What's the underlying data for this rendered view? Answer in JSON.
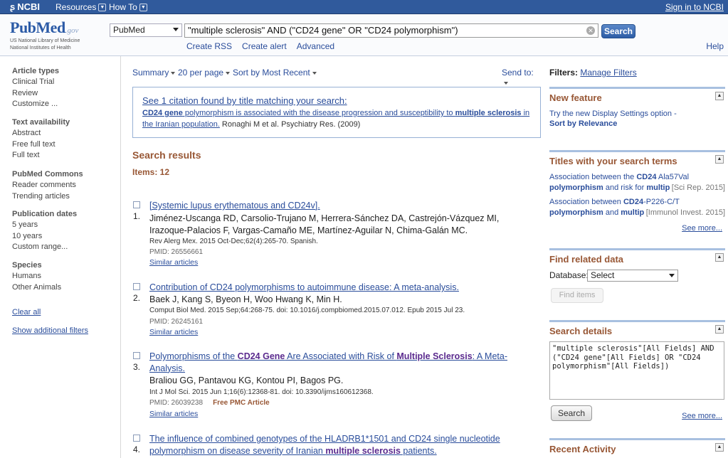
{
  "topbar": {
    "brand": "NCBI",
    "resources": "Resources",
    "howto": "How To",
    "signin": "Sign in to NCBI"
  },
  "header": {
    "logo_text": "PubMed",
    "logo_gov": ".gov",
    "nlm_line1": "US National Library of Medicine",
    "nlm_line2": "National Institutes of Health",
    "database": "PubMed",
    "query": "\"multiple sclerosis\" AND (\"CD24 gene\" OR \"CD24 polymorphism\")",
    "search_label": "Search",
    "create_rss": "Create RSS",
    "create_alert": "Create alert",
    "advanced": "Advanced",
    "help": "Help"
  },
  "sidebar": {
    "article_types": {
      "title": "Article types",
      "items": [
        "Clinical Trial",
        "Review",
        "Customize ..."
      ]
    },
    "text_availability": {
      "title": "Text availability",
      "items": [
        "Abstract",
        "Free full text",
        "Full text"
      ]
    },
    "pubmed_commons": {
      "title": "PubMed Commons",
      "items": [
        "Reader comments",
        "Trending articles"
      ]
    },
    "publication_dates": {
      "title": "Publication dates",
      "items": [
        "5 years",
        "10 years",
        "Custom range..."
      ]
    },
    "species": {
      "title": "Species",
      "items": [
        "Humans",
        "Other Animals"
      ]
    },
    "clear_all": "Clear all",
    "show_filters": "Show additional filters"
  },
  "toolbar": {
    "summary": "Summary",
    "per_page": "20 per page",
    "sort": "Sort by Most Recent",
    "send_to": "Send to:"
  },
  "citation": {
    "title": "See 1 citation found by title matching your search:",
    "link_part1": "CD24 gene",
    "link_part2": " polymorphism is associated with the disease progression and susceptibility to ",
    "link_part3": "multiple sclerosis",
    "link_part4": " in the Iranian population.",
    "source": " Ronaghi M et al. Psychiatry Res. (2009)"
  },
  "results": {
    "heading": "Search results",
    "count": "Items: 12",
    "items": [
      {
        "num": "1.",
        "title": "[Systemic lupus erythematous and CD24v].",
        "authors": "Jiménez-Uscanga RD, Carsolio-Trujano M, Herrera-Sánchez DA, Castrejón-Vázquez MI, Irazoque-Palacios F, Vargas-Camaño ME, Martínez-Aguilar N, Chima-Galán MC.",
        "journal": "Rev Alerg Mex. 2015 Oct-Dec;62(4):265-70. Spanish.",
        "pmid": "PMID: 26556661",
        "similar": "Similar articles"
      },
      {
        "num": "2.",
        "title": "Contribution of CD24 polymorphisms to autoimmune disease: A meta-analysis.",
        "authors": "Baek J, Kang S, Byeon H, Woo Hwang K, Min H.",
        "journal": "Comput Biol Med. 2015 Sep;64:268-75. doi: 10.1016/j.compbiomed.2015.07.012. Epub 2015 Jul 23.",
        "pmid": "PMID: 26245161",
        "similar": "Similar articles"
      },
      {
        "num": "3.",
        "title_a": "Polymorphisms of the ",
        "title_b": "CD24 Gene",
        "title_c": " Are Associated with Risk of ",
        "title_d": "Multiple Sclerosis",
        "title_e": ": A Meta-Analysis.",
        "authors": "Braliou GG, Pantavou KG, Kontou PI, Bagos PG.",
        "journal": "Int J Mol Sci. 2015 Jun 1;16(6):12368-81. doi: 10.3390/ijms160612368.",
        "pmid": "PMID: 26039238",
        "pmc": "Free PMC Article",
        "similar": "Similar articles"
      },
      {
        "num": "4.",
        "title_a": "The influence of combined genotypes of the HLADRB1*1501 and CD24 single nucleotide polymorphism on disease severity of Iranian ",
        "title_b": "multiple sclerosis",
        "title_c": " patients."
      }
    ]
  },
  "right": {
    "filters_label": "Filters:",
    "manage_filters": "Manage Filters",
    "new_feature": {
      "title": "New feature",
      "line1": "Try the new Display Settings option -",
      "line2": "Sort by Relevance"
    },
    "titles_terms": {
      "title": "Titles with your search terms",
      "items": [
        {
          "a": "Association between the ",
          "b": "CD24",
          "c": " Ala57Val ",
          "d": "polymorphism",
          "e": " and risk for ",
          "f": "multiple",
          "meta": "[Sci Rep. 2015]"
        },
        {
          "a": "Association between ",
          "b": "CD24",
          "c": "-P226-C/T ",
          "d": "polymorphism",
          "e": " and ",
          "f": "multiple",
          "meta": "[Immunol Invest. 2015]"
        }
      ],
      "see_more": "See more..."
    },
    "find_related": {
      "title": "Find related data",
      "db_label": "Database:",
      "db_value": "Select",
      "find_items": "Find items"
    },
    "search_details": {
      "title": "Search details",
      "query": "\"multiple sclerosis\"[All Fields] AND (\"CD24 gene\"[All Fields] OR \"CD24 polymorphism\"[All Fields])",
      "search_label": "Search",
      "see_more": "See more..."
    },
    "recent_activity": {
      "title": "Recent Activity"
    }
  }
}
